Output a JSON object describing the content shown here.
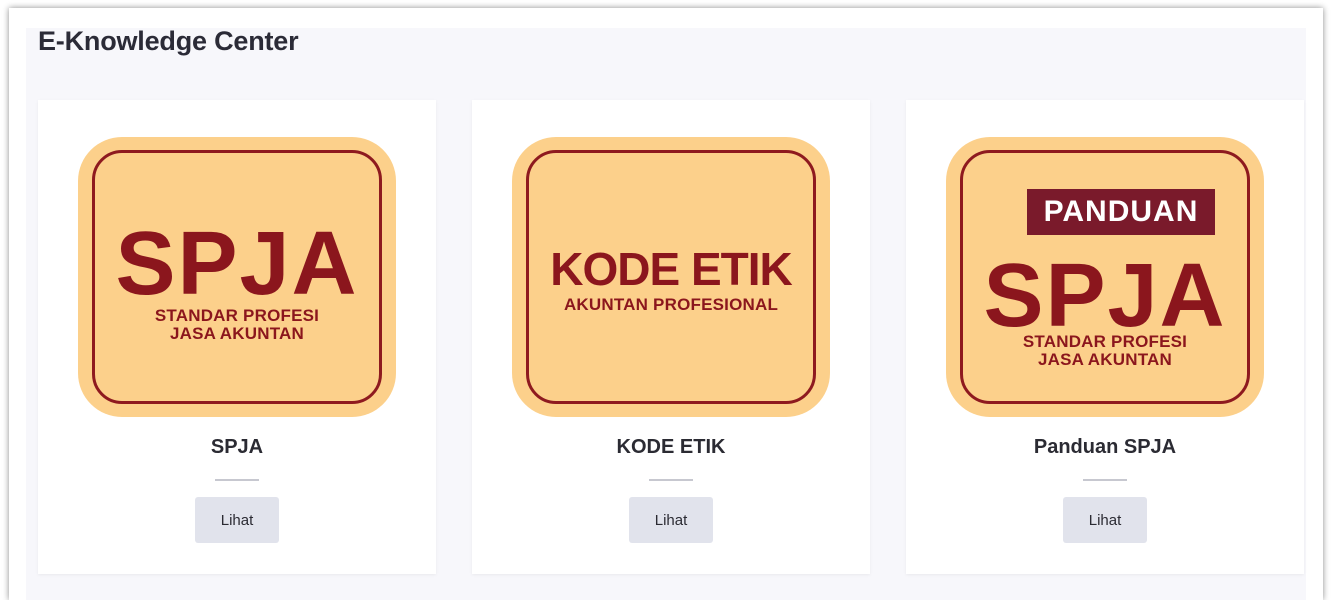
{
  "page": {
    "title": "E-Knowledge Center"
  },
  "cards": [
    {
      "title": "SPJA",
      "button": "Lihat",
      "cover": {
        "main": "SPJA",
        "sub1": "STANDAR PROFESI",
        "sub2": "JASA AKUNTAN"
      }
    },
    {
      "title": "KODE ETIK",
      "button": "Lihat",
      "cover": {
        "main": "KODE ETIK",
        "sub1": "AKUNTAN PROFESIONAL"
      }
    },
    {
      "title": "Panduan SPJA",
      "button": "Lihat",
      "cover": {
        "banner": "PANDUAN",
        "main": "SPJA",
        "sub1": "STANDAR PROFESI",
        "sub2": "JASA AKUNTAN"
      }
    }
  ],
  "colors": {
    "cover_bg": "#fcd08b",
    "cover_text": "#8b161d",
    "banner_bg": "#7a1a2b",
    "button_bg": "#e1e3ec"
  }
}
